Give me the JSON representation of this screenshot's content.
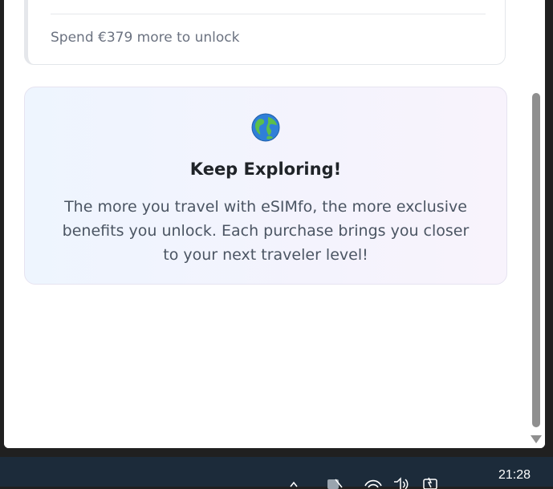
{
  "tier_card": {
    "progress_text": "Spend €379 more to unlock"
  },
  "explore": {
    "icon": "globe-icon",
    "title": "Keep Exploring!",
    "body": "The more you travel with eSIMfo, the more exclusive benefits you unlock. Each purchase brings you closer to your next traveler level!"
  },
  "taskbar": {
    "time": "21:28",
    "tray_icons": [
      "chevron-up-icon",
      "network-disconnected-icon",
      "wifi-icon",
      "volume-icon",
      "battery-icon"
    ]
  },
  "colors": {
    "card_gradient_start": "#eef5fe",
    "card_gradient_end": "#f8f3fc",
    "title_color": "#1f2328",
    "body_color": "#4b5563",
    "muted_text": "#6b7280",
    "taskbar": "#1c2b3a"
  }
}
